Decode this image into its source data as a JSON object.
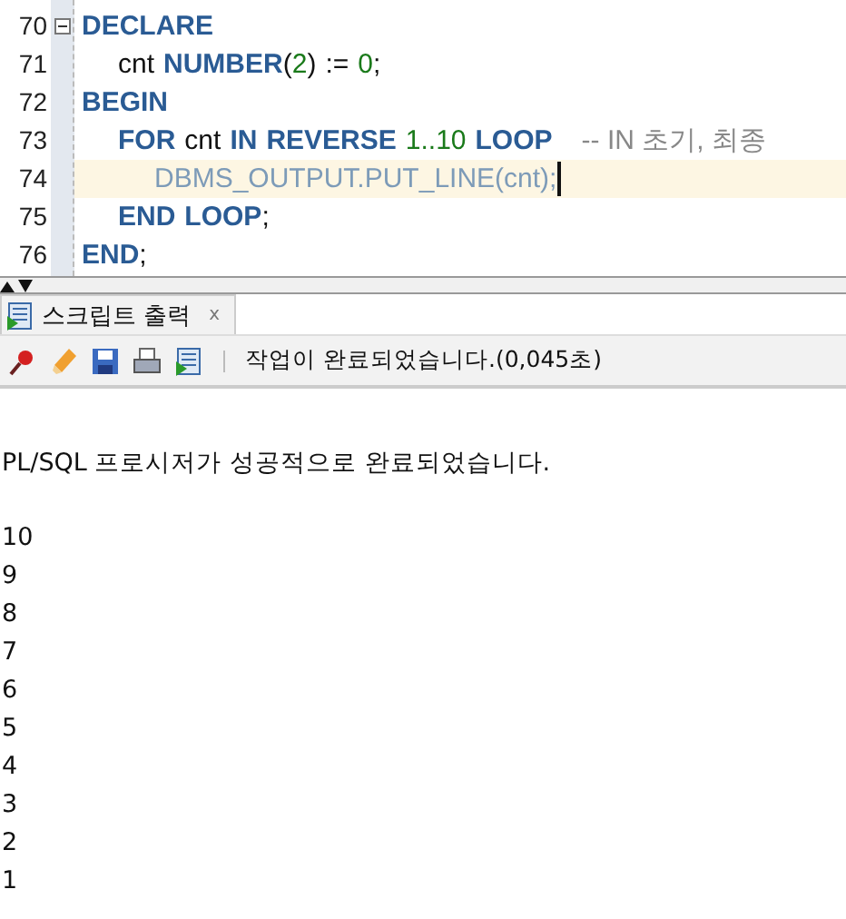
{
  "editor": {
    "lines": [
      {
        "number": "70",
        "kind": "outer",
        "fold": true,
        "current": false,
        "tokens": [
          {
            "kind": "keyword",
            "text": "DECLARE"
          }
        ]
      },
      {
        "number": "71",
        "kind": "inner",
        "fold": false,
        "current": false,
        "tokens": [
          {
            "kind": "ident",
            "text": "cnt"
          },
          {
            "kind": "keyword",
            "text": "NUMBER"
          },
          {
            "kind": "ident",
            "text": "(",
            "join": true
          },
          {
            "kind": "number",
            "text": "2",
            "join": true
          },
          {
            "kind": "ident",
            "text": ")",
            "join": true
          },
          {
            "kind": "ident",
            "text": ":="
          },
          {
            "kind": "number",
            "text": "0"
          },
          {
            "kind": "ident",
            "text": ";",
            "join": true
          }
        ]
      },
      {
        "number": "72",
        "kind": "outer",
        "fold": false,
        "current": false,
        "tokens": [
          {
            "kind": "keyword",
            "text": "BEGIN"
          }
        ]
      },
      {
        "number": "73",
        "kind": "inner",
        "fold": false,
        "current": false,
        "tokens": [
          {
            "kind": "keyword",
            "text": "FOR"
          },
          {
            "kind": "ident",
            "text": "cnt"
          },
          {
            "kind": "keyword",
            "text": "IN"
          },
          {
            "kind": "keyword",
            "text": "REVERSE"
          },
          {
            "kind": "number",
            "text": "1..10"
          },
          {
            "kind": "keyword",
            "text": "LOOP"
          },
          {
            "kind": "comment",
            "text": "-- IN 초기, 최종"
          }
        ]
      },
      {
        "number": "74",
        "kind": "deep",
        "fold": false,
        "current": true,
        "tokens": [
          {
            "kind": "call",
            "text": "DBMS_OUTPUT.PUT_LINE(cnt);"
          }
        ]
      },
      {
        "number": "75",
        "kind": "inner",
        "fold": false,
        "current": false,
        "tokens": [
          {
            "kind": "keyword",
            "text": "END"
          },
          {
            "kind": "keyword",
            "text": "LOOP"
          },
          {
            "kind": "ident",
            "text": ";",
            "join": true
          }
        ]
      },
      {
        "number": "76",
        "kind": "outer",
        "fold": false,
        "current": false,
        "tokens": [
          {
            "kind": "keyword",
            "text": "END"
          },
          {
            "kind": "ident",
            "text": ";",
            "join": true
          }
        ]
      }
    ]
  },
  "panel": {
    "tab": {
      "label": "스크립트 출력",
      "close": "x",
      "selected": true
    },
    "status": "작업이 완료되었습니다.(0,045초)",
    "message": "PL/SQL 프로시저가 성공적으로 완료되었습니다.",
    "lines": [
      "10",
      "9",
      "8",
      "7",
      "6",
      "5",
      "4",
      "3",
      "2",
      "1"
    ]
  }
}
